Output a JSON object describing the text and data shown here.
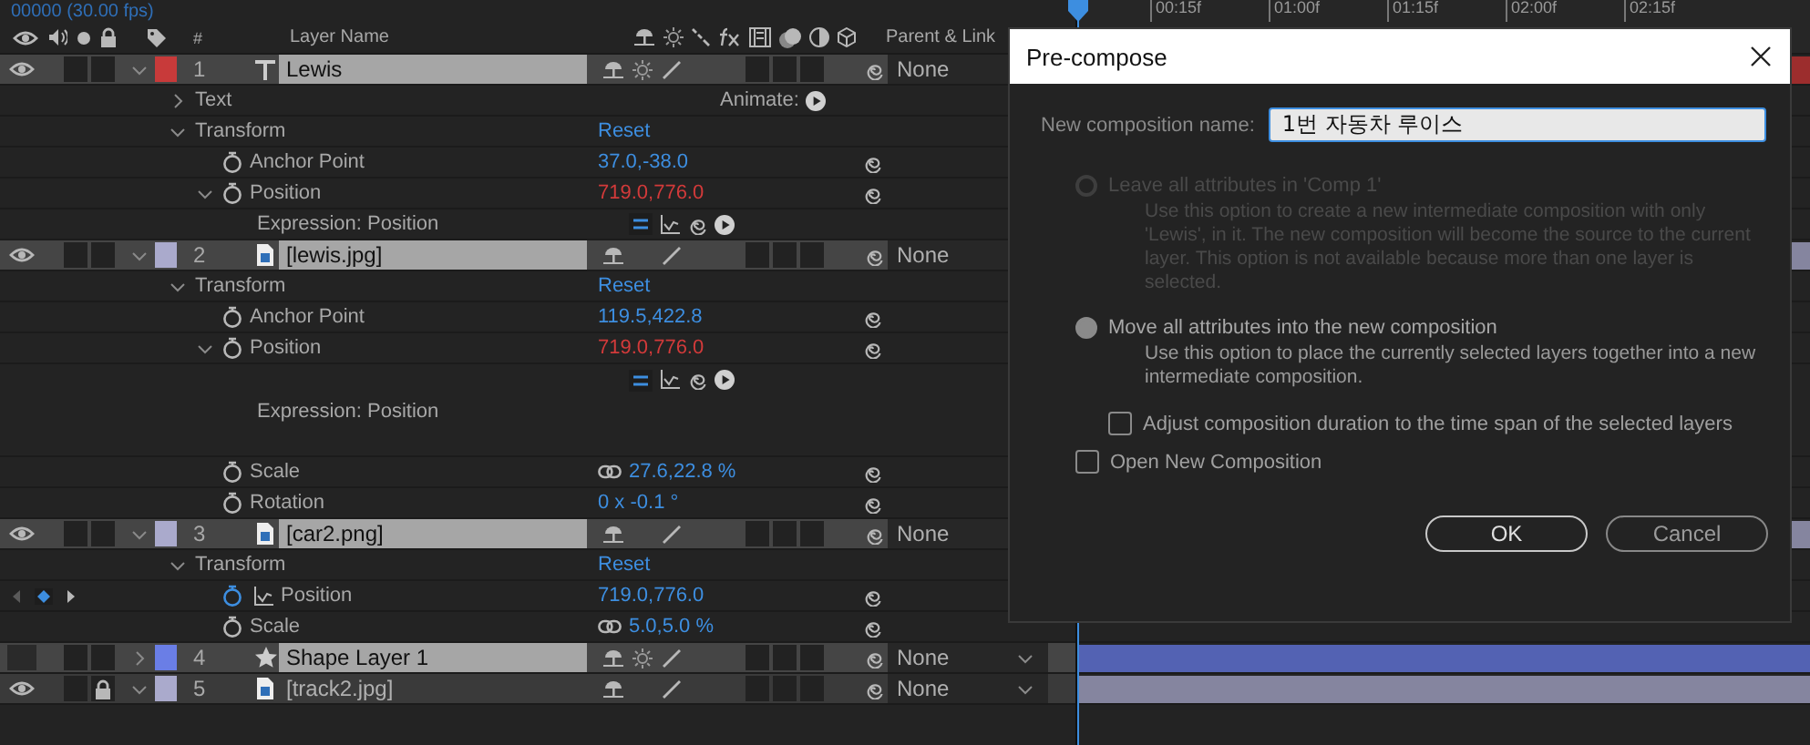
{
  "timecode": "00000 (30.00 fps)",
  "columns": {
    "number": "#",
    "layer_name": "Layer Name",
    "parent": "Parent & Link"
  },
  "ruler": [
    "00:15f",
    "01:00f",
    "01:15f",
    "02:00f",
    "02:15f"
  ],
  "layers": [
    {
      "number": "1",
      "name": "Lewis",
      "kind": "text",
      "color": "#c83a3a",
      "visible": true,
      "locked": false,
      "expanded": true,
      "selected": true,
      "collapse_switch": true,
      "parent": "None",
      "parent_dropdown": false,
      "children": [
        {
          "kind": "group",
          "name": "Text",
          "expanded": false,
          "action": "Animate:"
        },
        {
          "kind": "group",
          "name": "Transform",
          "expanded": true,
          "value": "Reset",
          "children": [
            {
              "kind": "property",
              "name": "Anchor Point",
              "value": "37.0,-38.0",
              "expression": false,
              "keyframed": false,
              "linked": false
            },
            {
              "kind": "property",
              "name": "Position",
              "value": "719.0,776.0",
              "expression": true,
              "keyframed": false,
              "linked": false,
              "expanded": true,
              "children": [
                {
                  "kind": "expression",
                  "name": "Expression: Position",
                  "editor_open": false
                }
              ]
            }
          ]
        }
      ]
    },
    {
      "number": "2",
      "name": "[lewis.jpg]",
      "kind": "footage",
      "color": "#aaaacc",
      "visible": true,
      "locked": false,
      "expanded": true,
      "selected": true,
      "collapse_switch": false,
      "parent": "None",
      "parent_dropdown": false,
      "children": [
        {
          "kind": "group",
          "name": "Transform",
          "expanded": true,
          "value": "Reset",
          "children": [
            {
              "kind": "property",
              "name": "Anchor Point",
              "value": "119.5,422.8",
              "expression": false,
              "keyframed": false,
              "linked": false
            },
            {
              "kind": "property",
              "name": "Position",
              "value": "719.0,776.0",
              "expression": true,
              "keyframed": false,
              "linked": false,
              "expanded": true,
              "children": [
                {
                  "kind": "expression",
                  "name": "Expression: Position",
                  "editor_open": true
                }
              ]
            },
            {
              "kind": "property",
              "name": "Scale",
              "value": "27.6,22.8 %",
              "expression": false,
              "keyframed": false,
              "linked": true
            },
            {
              "kind": "property",
              "name": "Rotation",
              "value": "0 x -0.1 °",
              "expression": false,
              "keyframed": false,
              "linked": false
            }
          ]
        }
      ]
    },
    {
      "number": "3",
      "name": "[car2.png]",
      "kind": "footage",
      "color": "#aaaacc",
      "visible": true,
      "locked": false,
      "expanded": true,
      "selected": true,
      "collapse_switch": false,
      "parent": "None",
      "parent_dropdown": false,
      "children": [
        {
          "kind": "group",
          "name": "Transform",
          "expanded": true,
          "value": "Reset",
          "children": [
            {
              "kind": "property",
              "name": "Position",
              "value": "719.0,776.0",
              "expression": false,
              "keyframed": true,
              "linked": false
            },
            {
              "kind": "property",
              "name": "Scale",
              "value": "5.0,5.0 %",
              "expression": false,
              "keyframed": false,
              "linked": true
            }
          ]
        }
      ]
    },
    {
      "number": "4",
      "name": "Shape Layer 1",
      "kind": "shape",
      "color": "#6a7ee6",
      "visible": false,
      "locked": false,
      "expanded": false,
      "selected": true,
      "collapse_switch": true,
      "parent": "None",
      "parent_dropdown": true
    },
    {
      "number": "5",
      "name": "[track2.jpg]",
      "kind": "footage",
      "color": "#aaaacc",
      "visible": true,
      "locked": true,
      "expanded": true,
      "selected": false,
      "collapse_switch": false,
      "parent": "None",
      "parent_dropdown": true
    }
  ],
  "dialog": {
    "title": "Pre-compose",
    "name_label": "New composition name:",
    "name_value": "1번 자동차 루이스",
    "options": [
      {
        "label": "Leave all attributes in 'Comp 1'",
        "description": "Use this option to create a new intermediate composition with only 'Lewis', in it. The new composition will become the source to the current layer. This option is not available because more than one layer is selected.",
        "selected": false,
        "disabled": true
      },
      {
        "label": "Move all attributes into the new composition",
        "description": "Use this option to place the currently selected layers together into a new intermediate composition.",
        "selected": true,
        "disabled": false
      }
    ],
    "checkboxes": [
      {
        "label": "Adjust composition duration to the time span of the selected layers",
        "checked": false,
        "indented": true
      },
      {
        "label": "Open New Composition",
        "checked": false,
        "indented": false
      }
    ],
    "buttons": [
      {
        "label": "OK",
        "kind": "primary"
      },
      {
        "label": "Cancel",
        "kind": "secondary"
      }
    ]
  }
}
